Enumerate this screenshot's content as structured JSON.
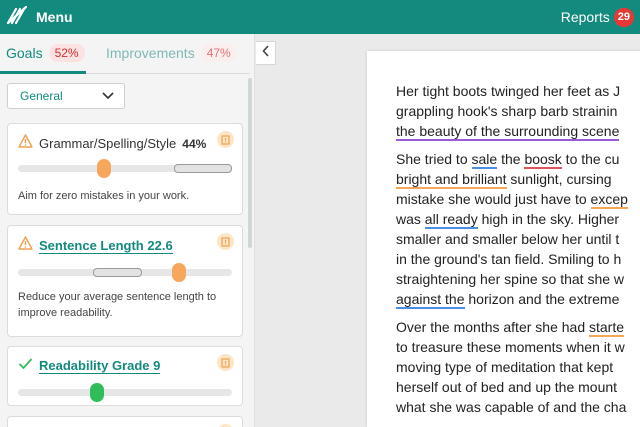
{
  "header": {
    "menu_label": "Menu",
    "reports_label": "Reports",
    "reports_count": "29"
  },
  "tabs": {
    "goals": {
      "label": "Goals",
      "score": "52%"
    },
    "improvements": {
      "label": "Improvements",
      "score": "47%"
    }
  },
  "filter": {
    "selected": "General"
  },
  "cards": [
    {
      "title": "Grammar/Spelling/Style",
      "value": "44%",
      "description": "Aim for zero mistakes in your work.",
      "level": 0.4,
      "target_range": [
        0.73,
        1.0
      ]
    },
    {
      "title": "Sentence Length",
      "value": "22.6",
      "description_lines": [
        "Reduce your average sentence length to",
        "improve readability."
      ],
      "level": 0.75,
      "target_range": [
        0.35,
        0.58
      ]
    },
    {
      "title": "Readability Grade",
      "value": "9",
      "level": 0.37
    }
  ],
  "document": {
    "paragraphs": [
      [
        [
          {
            "t": "Her tight boots twinged her feet as J"
          }
        ],
        [
          {
            "t": "grappling hook's sharp barb strainin"
          }
        ],
        [
          {
            "t": "the beauty of the surrounding scene",
            "u": "purple"
          }
        ]
      ],
      [
        [
          {
            "t": "She tried to "
          },
          {
            "t": "sale",
            "u": "blue"
          },
          {
            "t": " the "
          },
          {
            "t": "boosk",
            "u": "red"
          },
          {
            "t": " to the cu"
          }
        ],
        [
          {
            "t": "bright and brilliant",
            "u": "orange"
          },
          {
            "t": " sunlight, cursing"
          }
        ],
        [
          {
            "t": "mistake she would just have to "
          },
          {
            "t": "excep",
            "u": "orange"
          }
        ],
        [
          {
            "t": "was "
          },
          {
            "t": "all ready",
            "u": "blue"
          },
          {
            "t": " high in the sky. Higher"
          }
        ],
        [
          {
            "t": "smaller and smaller below her until t"
          }
        ],
        [
          {
            "t": "in the ground's tan field. Smiling to h"
          }
        ],
        [
          {
            "t": "straightening her spine so that she w"
          }
        ],
        [
          {
            "t": "against  the",
            "u": "blue"
          },
          {
            "t": " horizon and the extreme"
          }
        ]
      ],
      [
        [
          {
            "t": "Over the months after she had "
          },
          {
            "t": "starte",
            "u": "orange"
          }
        ],
        [
          {
            "t": "to treasure these moments when it w"
          }
        ],
        [
          {
            "t": "moving type of meditation that kept"
          }
        ],
        [
          {
            "t": "herself out of bed and up the mount"
          }
        ],
        [
          {
            "t": "what she was capable of and the cha"
          }
        ]
      ]
    ]
  },
  "colors": {
    "brand": "#138a7e",
    "badge": "#e53935",
    "warning": "#f5a65b",
    "success": "#2ebd58",
    "error_underline": "#e0555a",
    "clarity_underline": "#4a90e2",
    "style_underline": "#9c5bd6"
  },
  "icons": {
    "menu": "feather-logo-icon",
    "warning": "warning-triangle-icon",
    "check": "check-icon",
    "flag": "flag-icon",
    "dropdown": "chevron-down-icon",
    "collapse": "chevron-left-icon"
  }
}
